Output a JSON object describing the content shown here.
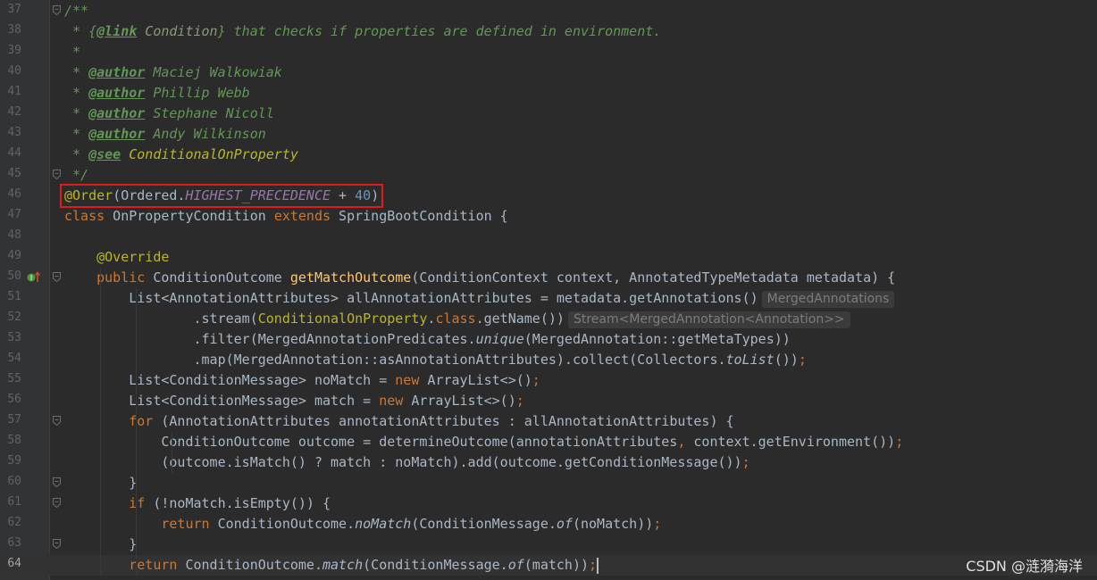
{
  "editor": {
    "language": "java",
    "current_line": "64",
    "highlighted_line": "46",
    "lines": [
      {
        "number": "37",
        "tokens": [
          {
            "t": "/**",
            "c": "comment"
          }
        ]
      },
      {
        "number": "38",
        "tokens": [
          {
            "t": " * {",
            "c": "comment"
          },
          {
            "t": "@link",
            "c": "tag"
          },
          {
            "t": " Condition",
            "c": "doclink"
          },
          {
            "t": "} that checks if properties are defined in environment.",
            "c": "comment"
          }
        ]
      },
      {
        "number": "39",
        "tokens": [
          {
            "t": " *",
            "c": "comment"
          }
        ]
      },
      {
        "number": "40",
        "tokens": [
          {
            "t": " * ",
            "c": "comment"
          },
          {
            "t": "@author",
            "c": "tag"
          },
          {
            "t": " Maciej Walkowiak",
            "c": "comment"
          }
        ]
      },
      {
        "number": "41",
        "tokens": [
          {
            "t": " * ",
            "c": "comment"
          },
          {
            "t": "@author",
            "c": "tag"
          },
          {
            "t": " Phillip Webb",
            "c": "comment"
          }
        ]
      },
      {
        "number": "42",
        "tokens": [
          {
            "t": " * ",
            "c": "comment"
          },
          {
            "t": "@author",
            "c": "tag"
          },
          {
            "t": " Stephane Nicoll",
            "c": "comment"
          }
        ]
      },
      {
        "number": "43",
        "tokens": [
          {
            "t": " * ",
            "c": "comment"
          },
          {
            "t": "@author",
            "c": "tag"
          },
          {
            "t": " Andy Wilkinson",
            "c": "comment"
          }
        ]
      },
      {
        "number": "44",
        "tokens": [
          {
            "t": " * ",
            "c": "comment"
          },
          {
            "t": "@see",
            "c": "tag"
          },
          {
            "t": " ConditionalOnProperty",
            "c": "doclinkgold"
          }
        ]
      },
      {
        "number": "45",
        "tokens": [
          {
            "t": " */",
            "c": "comment"
          }
        ]
      },
      {
        "number": "46",
        "tokens": [
          {
            "t": "@Order",
            "c": "annotation"
          },
          {
            "t": "(Ordered.",
            "c": "ident"
          },
          {
            "t": "HIGHEST_PRECEDENCE",
            "c": "static"
          },
          {
            "t": " + ",
            "c": "ident"
          },
          {
            "t": "40",
            "c": "number"
          },
          {
            "t": ")",
            "c": "ident"
          }
        ]
      },
      {
        "number": "47",
        "tokens": [
          {
            "t": "class",
            "c": "keyword"
          },
          {
            "t": " OnPropertyCondition ",
            "c": "ident"
          },
          {
            "t": "extends",
            "c": "keyword"
          },
          {
            "t": " SpringBootCondition {",
            "c": "ident"
          }
        ]
      },
      {
        "number": "48",
        "tokens": []
      },
      {
        "number": "49",
        "tokens": [
          {
            "t": "    ",
            "c": "ident"
          },
          {
            "t": "@Override",
            "c": "annotation"
          }
        ]
      },
      {
        "number": "50",
        "tokens": [
          {
            "t": "    ",
            "c": "ident"
          },
          {
            "t": "public",
            "c": "keyword"
          },
          {
            "t": " ConditionOutcome ",
            "c": "ident"
          },
          {
            "t": "getMatchOutcome",
            "c": "method"
          },
          {
            "t": "(ConditionContext context, AnnotatedTypeMetadata metadata) {",
            "c": "ident"
          }
        ]
      },
      {
        "number": "51",
        "tokens": [
          {
            "t": "        List<AnnotationAttributes> allAnnotationAttributes = metadata.getAnnotations()",
            "c": "ident"
          }
        ],
        "hint": "MergedAnnotations"
      },
      {
        "number": "52",
        "tokens": [
          {
            "t": "                .stream(",
            "c": "ident"
          },
          {
            "t": "ConditionalOnProperty",
            "c": "annotation"
          },
          {
            "t": ".",
            "c": "ident"
          },
          {
            "t": "class",
            "c": "keyword"
          },
          {
            "t": ".getName())",
            "c": "ident"
          }
        ],
        "hint": "Stream<MergedAnnotation<Annotation>>"
      },
      {
        "number": "53",
        "tokens": [
          {
            "t": "                .filter(MergedAnnotationPredicates.",
            "c": "ident"
          },
          {
            "t": "unique",
            "c": "italic"
          },
          {
            "t": "(MergedAnnotation::getMetaTypes))",
            "c": "ident"
          }
        ]
      },
      {
        "number": "54",
        "tokens": [
          {
            "t": "                .map(MergedAnnotation::asAnnotationAttributes).collect(Collectors.",
            "c": "ident"
          },
          {
            "t": "toList",
            "c": "italic"
          },
          {
            "t": "())",
            "c": "ident"
          },
          {
            "t": ";",
            "c": "keyword"
          }
        ]
      },
      {
        "number": "55",
        "tokens": [
          {
            "t": "        List<ConditionMessage> noMatch = ",
            "c": "ident"
          },
          {
            "t": "new",
            "c": "keyword"
          },
          {
            "t": " ArrayList<>()",
            "c": "ident"
          },
          {
            "t": ";",
            "c": "keyword"
          }
        ]
      },
      {
        "number": "56",
        "tokens": [
          {
            "t": "        List<ConditionMessage> match = ",
            "c": "ident"
          },
          {
            "t": "new",
            "c": "keyword"
          },
          {
            "t": " ArrayList<>()",
            "c": "ident"
          },
          {
            "t": ";",
            "c": "keyword"
          }
        ]
      },
      {
        "number": "57",
        "tokens": [
          {
            "t": "        ",
            "c": "ident"
          },
          {
            "t": "for",
            "c": "keyword"
          },
          {
            "t": " (AnnotationAttributes annotationAttributes : allAnnotationAttributes) {",
            "c": "ident"
          }
        ]
      },
      {
        "number": "58",
        "tokens": [
          {
            "t": "            ConditionOutcome outcome = determineOutcome(annotationAttributes",
            "c": "ident"
          },
          {
            "t": ",",
            "c": "keyword"
          },
          {
            "t": " context.getEnvironment())",
            "c": "ident"
          },
          {
            "t": ";",
            "c": "keyword"
          }
        ]
      },
      {
        "number": "59",
        "tokens": [
          {
            "t": "            (outcome.isMatch() ? match : noMatch).add(outcome.getConditionMessage())",
            "c": "ident"
          },
          {
            "t": ";",
            "c": "keyword"
          }
        ]
      },
      {
        "number": "60",
        "tokens": [
          {
            "t": "        }",
            "c": "ident"
          }
        ]
      },
      {
        "number": "61",
        "tokens": [
          {
            "t": "        ",
            "c": "ident"
          },
          {
            "t": "if",
            "c": "keyword"
          },
          {
            "t": " (!noMatch.isEmpty()) {",
            "c": "ident"
          }
        ]
      },
      {
        "number": "62",
        "tokens": [
          {
            "t": "            ",
            "c": "ident"
          },
          {
            "t": "return",
            "c": "keyword"
          },
          {
            "t": " ConditionOutcome.",
            "c": "ident"
          },
          {
            "t": "noMatch",
            "c": "italic"
          },
          {
            "t": "(ConditionMessage.",
            "c": "ident"
          },
          {
            "t": "of",
            "c": "italic"
          },
          {
            "t": "(noMatch))",
            "c": "ident"
          },
          {
            "t": ";",
            "c": "keyword"
          }
        ]
      },
      {
        "number": "63",
        "tokens": [
          {
            "t": "        }",
            "c": "ident"
          }
        ]
      },
      {
        "number": "64",
        "tokens": [
          {
            "t": "        ",
            "c": "ident"
          },
          {
            "t": "return",
            "c": "keyword"
          },
          {
            "t": " ConditionOutcome.",
            "c": "ident"
          },
          {
            "t": "match",
            "c": "italic"
          },
          {
            "t": "(ConditionMessage.",
            "c": "ident"
          },
          {
            "t": "of",
            "c": "italic"
          },
          {
            "t": "(match))",
            "c": "ident"
          },
          {
            "t": ";",
            "c": "keyword"
          }
        ]
      }
    ],
    "fold_markers": [
      "37",
      "45",
      "50",
      "57",
      "60",
      "61",
      "63"
    ],
    "gutter_icons": [
      {
        "line": "50",
        "icon": "override-implements-icon"
      }
    ]
  },
  "watermark": "CSDN @涟漪海洋",
  "colors": {
    "background": "#2b2b2b",
    "gutter": "#313335",
    "comment": "#629755",
    "keyword": "#cc7832",
    "annotation": "#bbb529",
    "method": "#ffc66d",
    "static_field": "#9876aa",
    "number": "#6897bb",
    "highlight_box": "#e01b1b"
  }
}
